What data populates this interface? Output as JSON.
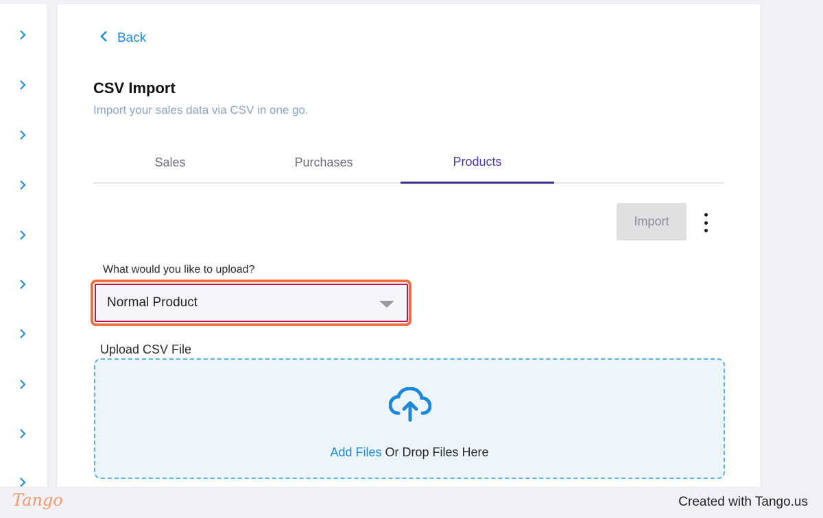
{
  "sidebar": {
    "items": [
      {
        "icon": "chevron-right-icon"
      },
      {
        "icon": "chevron-right-icon"
      },
      {
        "icon": "chevron-right-icon"
      },
      {
        "icon": "chevron-right-icon"
      },
      {
        "icon": "chevron-right-icon"
      },
      {
        "icon": "chevron-right-icon"
      },
      {
        "icon": "chevron-right-icon"
      },
      {
        "icon": "chevron-right-icon"
      },
      {
        "icon": "chevron-right-icon"
      },
      {
        "icon": "chevron-right-icon"
      }
    ]
  },
  "header": {
    "back_label": "Back",
    "title": "CSV Import",
    "subtitle": "Import your sales data via CSV in one go."
  },
  "tabs": [
    {
      "label": "Sales",
      "active": false
    },
    {
      "label": "Purchases",
      "active": false
    },
    {
      "label": "Products",
      "active": true
    }
  ],
  "toolbar": {
    "import_label": "Import",
    "more_icon": "kebab-menu-icon"
  },
  "form": {
    "upload_type_label": "What would you like to upload?",
    "upload_type_value": "Normal Product",
    "upload_csv_label": "Upload CSV File",
    "dropzone": {
      "add_files_link": "Add Files",
      "drop_text": " Or Drop Files Here",
      "icon": "cloud-upload-icon"
    }
  },
  "footer": {
    "logo_text": "Tango",
    "created_text": "Created with Tango.us"
  },
  "colors": {
    "accent_blue": "#1e88d8",
    "tab_active": "#3c2f8f",
    "highlight": "#f0703f",
    "select_border": "#b8174b",
    "dropzone_bg": "#ebf5fa"
  }
}
